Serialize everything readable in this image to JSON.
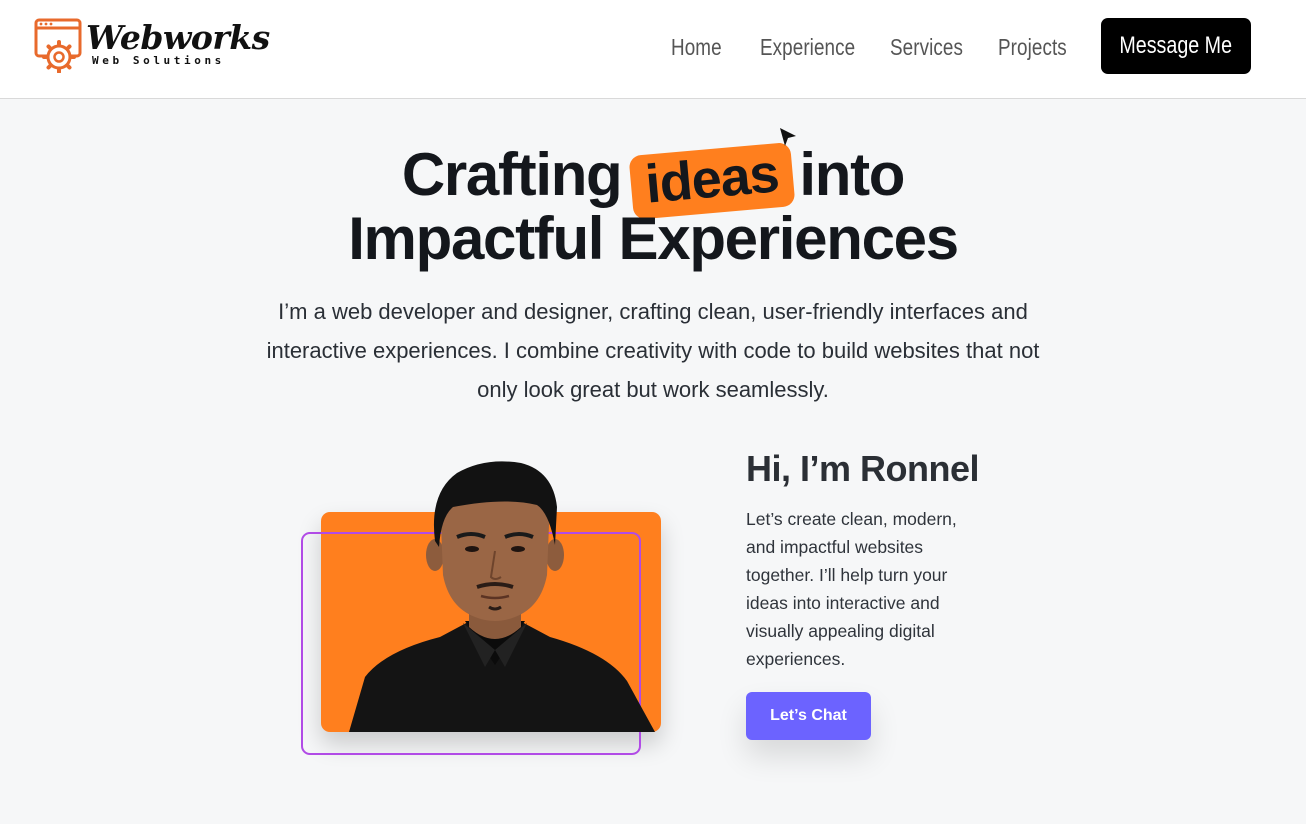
{
  "brand": {
    "name": "Webworks",
    "tagline": "Web Solutions",
    "logo_icon": "browser-gear-icon",
    "accent_color": "#e86a2c"
  },
  "nav": {
    "items": [
      {
        "label": "Home"
      },
      {
        "label": "Experience"
      },
      {
        "label": "Services"
      },
      {
        "label": "Projects"
      }
    ],
    "cta_label": "Message Me"
  },
  "hero": {
    "headline_pre": "Crafting",
    "headline_highlight": "ideas",
    "headline_post": "into",
    "headline_line2": "Impactful Experiences",
    "highlight_color": "#ff7f1e",
    "cursor_icon": "pointer-arrow-icon",
    "intro": "I’m a web developer and designer, crafting clean, user-friendly interfaces and interactive experiences. I combine creativity with code to build websites that not only look great but work seamlessly."
  },
  "profile": {
    "greeting": "Hi, I’m Ronnel",
    "pitch": "Let’s create clean, modern, and impactful websites together. I’ll help turn your ideas into interactive and visually appealing digital experiences.",
    "cta_label": "Let’s Chat",
    "cta_color": "#6c63ff",
    "card_color": "#ff7f1e",
    "outline_color": "#b14be6"
  }
}
